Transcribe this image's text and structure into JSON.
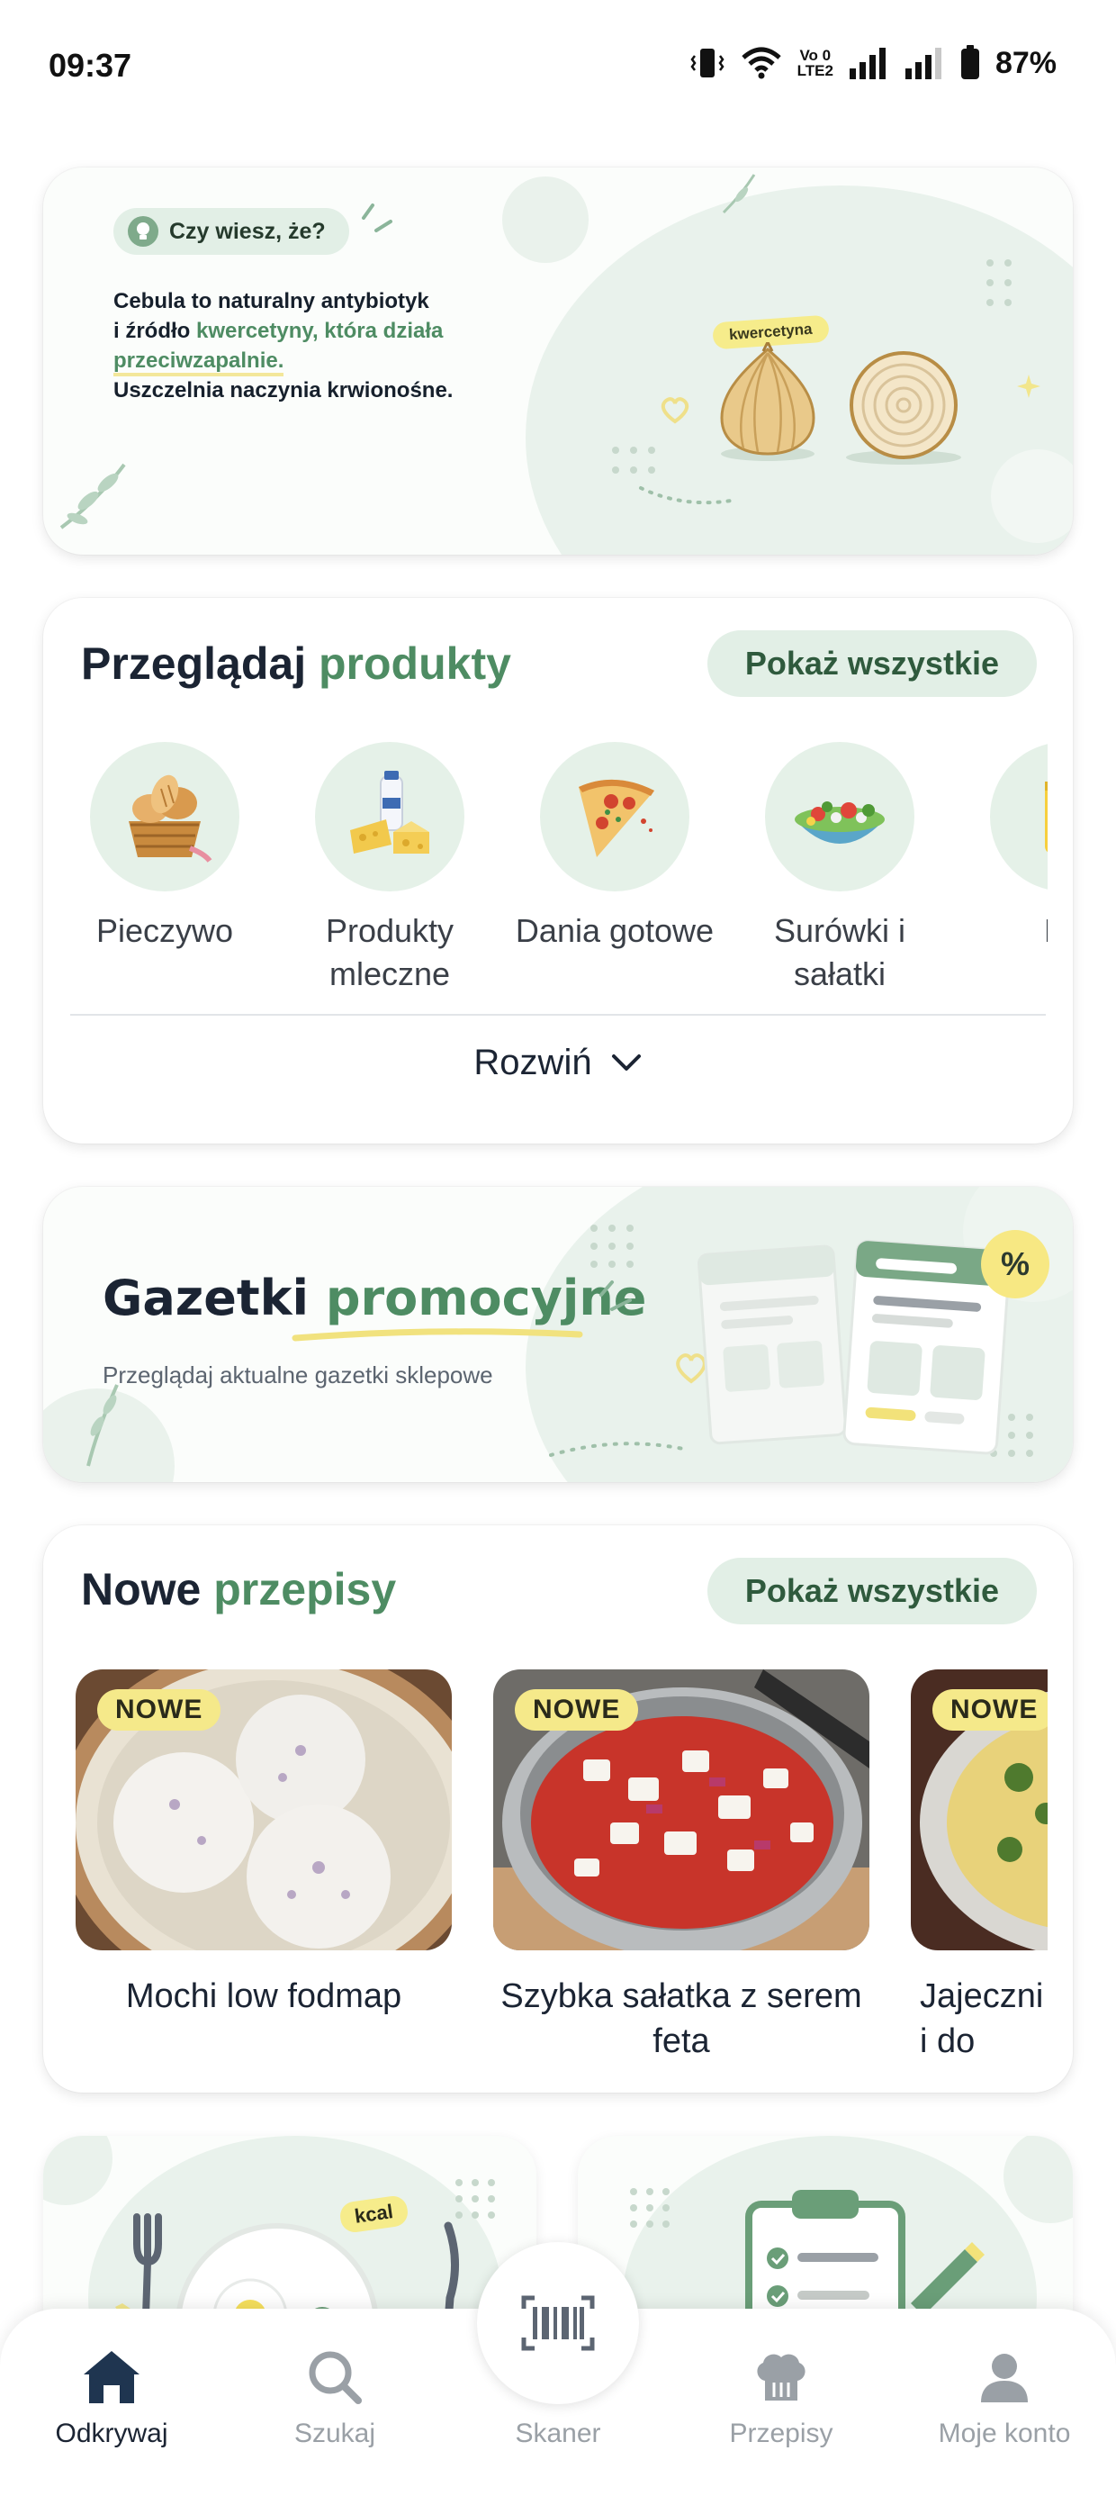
{
  "status_bar": {
    "time": "09:37",
    "battery": "87%",
    "network_label": "Vo LTE2"
  },
  "tip": {
    "pill_label": "Czy wiesz, że?",
    "line1": "Cebula to naturalny antybiotyk",
    "line2_prefix": "i źródło ",
    "line2_highlight": "kwercetyny, która działa",
    "line3_highlight": "przeciwzapalnie.",
    "line4": "Uszczelnia naczynia krwionośne.",
    "onion_tag": "kwercetyna"
  },
  "categories": {
    "title_part1": "Przeglądaj",
    "title_part2": "produkty",
    "show_all": "Pokaż wszystkie",
    "items": [
      {
        "label": "Pieczywo",
        "icon": "bread-basket-icon"
      },
      {
        "label": "Produkty mleczne",
        "icon": "dairy-icon"
      },
      {
        "label": "Dania gotowe",
        "icon": "pizza-icon"
      },
      {
        "label": "Surówki i sałatki",
        "icon": "salad-icon"
      },
      {
        "label": "Na",
        "icon": "drink-icon"
      }
    ],
    "expand_label": "Rozwiń"
  },
  "promo": {
    "title_part1": "Gazetki",
    "title_part2": "promocyjne",
    "subtitle": "Przeglądaj aktualne gazetki sklepowe",
    "badge": "%"
  },
  "recipes": {
    "title_part1": "Nowe",
    "title_part2": "przepisy",
    "show_all": "Pokaż wszystkie",
    "items": [
      {
        "badge": "NOWE",
        "name": "Mochi low fodmap"
      },
      {
        "badge": "NOWE",
        "name": "Szybka sałatka z serem feta"
      },
      {
        "badge": "NOWE",
        "name": "Jajeczni i do"
      }
    ]
  },
  "tiles": {
    "kcal_label": "kcal"
  },
  "nav": {
    "items": [
      {
        "label": "Odkrywaj",
        "icon": "home-icon",
        "active": true
      },
      {
        "label": "Szukaj",
        "icon": "search-icon",
        "active": false
      },
      {
        "label": "Skaner",
        "icon": "barcode-icon",
        "active": false
      },
      {
        "label": "Przepisy",
        "icon": "chef-hat-icon",
        "active": false
      },
      {
        "label": "Moje konto",
        "icon": "user-icon",
        "active": false
      }
    ]
  },
  "colors": {
    "accent_green": "#4e8c63",
    "pill_green": "#e2efe6",
    "badge_yellow": "#f5e98a",
    "text_dark": "#1b2433"
  }
}
